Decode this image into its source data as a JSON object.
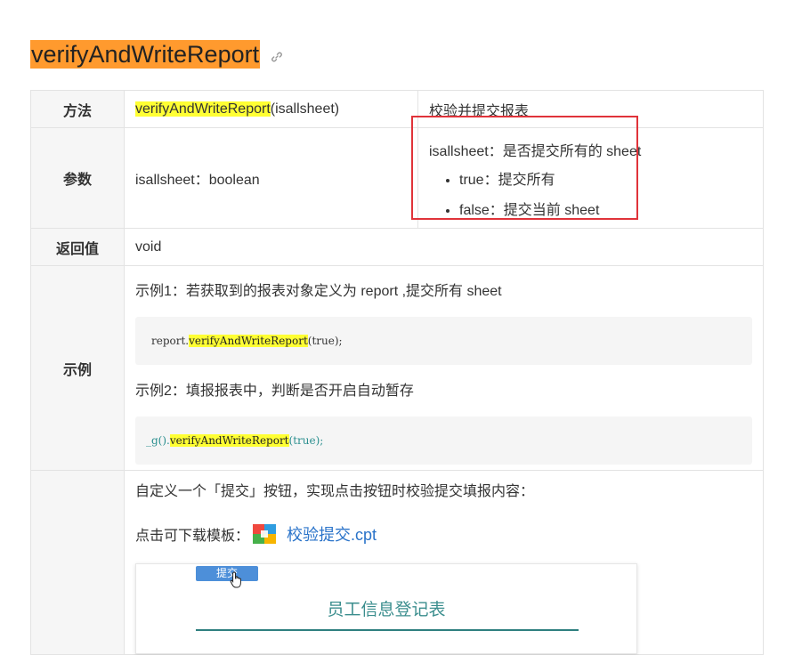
{
  "heading": {
    "title": "verifyAndWriteReport",
    "link_icon": "link-icon"
  },
  "method_row": {
    "label": "方法",
    "signature_name": "verifyAndWriteReport",
    "signature_args": "(isallsheet)",
    "description": "校验并提交报表"
  },
  "params_row": {
    "label": "参数",
    "param": "isallsheet：boolean",
    "desc_title": "isallsheet：是否提交所有的 sheet",
    "options": [
      "true：提交所有",
      "false：提交当前 sheet"
    ]
  },
  "return_row": {
    "label": "返回值",
    "value": "void"
  },
  "example_row": {
    "label": "示例",
    "example1_text": "示例1：若获取到的报表对象定义为 report ,提交所有 sheet",
    "example1_code_prefix": "report.",
    "example1_code_fn": "verifyAndWriteReport",
    "example1_code_suffix": "(true);",
    "example2_text": "示例2：填报报表中，判断是否开启自动暂存",
    "example2_code_prefix": "_g().",
    "example2_code_fn": "verifyAndWriteReport",
    "example2_code_suffix": "(true);"
  },
  "demo_row": {
    "desc": "自定义一个「提交」按钮，实现点击按钮时校验提交填报内容：",
    "download_label": "点击可下载模板：",
    "file_name": "校验提交.cpt",
    "preview_button": "提交",
    "preview_title": "员工信息登记表"
  },
  "colors": {
    "heading_bg": "#ff9a2e",
    "highlight": "#ffff33",
    "callout_border": "#e0333a",
    "link": "#2a73c9"
  }
}
